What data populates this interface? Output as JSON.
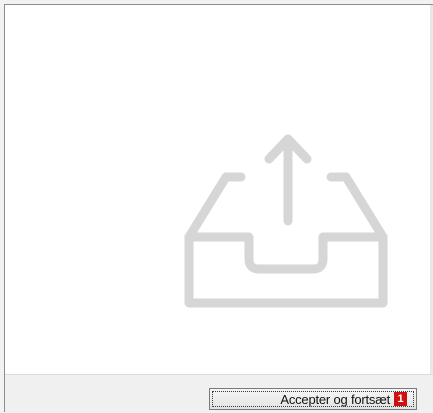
{
  "illustration": {
    "icon": "upload-tray-icon",
    "color": "#d6d6d6"
  },
  "footer": {
    "accept_button_label": "Accepter og fortsæt",
    "step_badge": "1",
    "badge_color": "#d01010"
  }
}
